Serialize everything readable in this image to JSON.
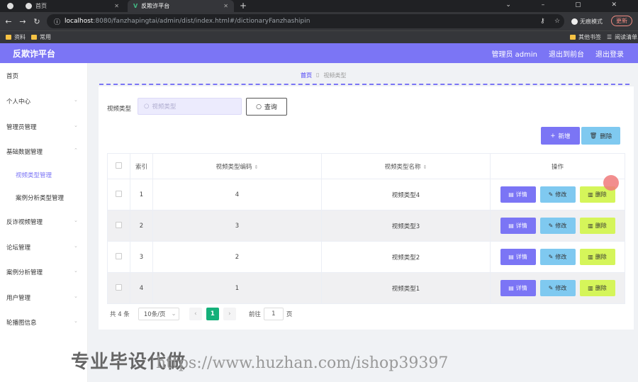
{
  "browser": {
    "tabs": [
      {
        "label": "首页",
        "active": false
      },
      {
        "label": "反欺诈平台",
        "active": true
      }
    ],
    "url_host": "localhost",
    "url_path": ":8080/fanzhapingtai/admin/dist/index.html#/dictionaryFanzhashipin",
    "incognito_label": "无痕模式",
    "update_label": "更新",
    "bookmarks": [
      "资料",
      "常用"
    ],
    "bookmarks_right": [
      "其他书签",
      "阅读清单"
    ]
  },
  "header": {
    "brand": "反欺诈平台",
    "user": "管理员 admin",
    "back_front": "退出到前台",
    "logout": "退出登录"
  },
  "sidebar": {
    "items": [
      {
        "label": "首页"
      },
      {
        "label": "个人中心"
      },
      {
        "label": "管理员管理"
      },
      {
        "label": "基础数据管理"
      },
      {
        "label": "视频类型管理"
      },
      {
        "label": "案例分析类型管理"
      },
      {
        "label": "反诈视频管理"
      },
      {
        "label": "论坛管理"
      },
      {
        "label": "案例分析管理"
      },
      {
        "label": "用户管理"
      },
      {
        "label": "轮播图信息"
      }
    ]
  },
  "breadcrumb": {
    "home": "首页",
    "current": "视频类型"
  },
  "search": {
    "label": "视频类型",
    "placeholder": "视频类型",
    "button": "查询"
  },
  "actions": {
    "add": "新增",
    "delete": "删除"
  },
  "table": {
    "headers": [
      "索引",
      "视频类型编码",
      "视频类型名称",
      "操作"
    ],
    "rows": [
      {
        "index": "1",
        "code": "4",
        "name": "视频类型4"
      },
      {
        "index": "2",
        "code": "3",
        "name": "视频类型3"
      },
      {
        "index": "3",
        "code": "2",
        "name": "视频类型2"
      },
      {
        "index": "4",
        "code": "1",
        "name": "视频类型1"
      }
    ],
    "op_detail": "详情",
    "op_edit": "修改",
    "op_delete": "删除"
  },
  "pagination": {
    "total": "共 4 条",
    "page_size": "10条/页",
    "current_page": "1",
    "goto_label": "前往",
    "goto_value": "1",
    "page_suffix": "页"
  },
  "watermark": {
    "text": "专业毕设代做",
    "url": "https://www.huzhan.com/ishop39397"
  },
  "colors": {
    "accent": "#7b75f5",
    "edit": "#7fc9f0",
    "delete": "#d5f55a",
    "page_active": "#15b07a"
  }
}
